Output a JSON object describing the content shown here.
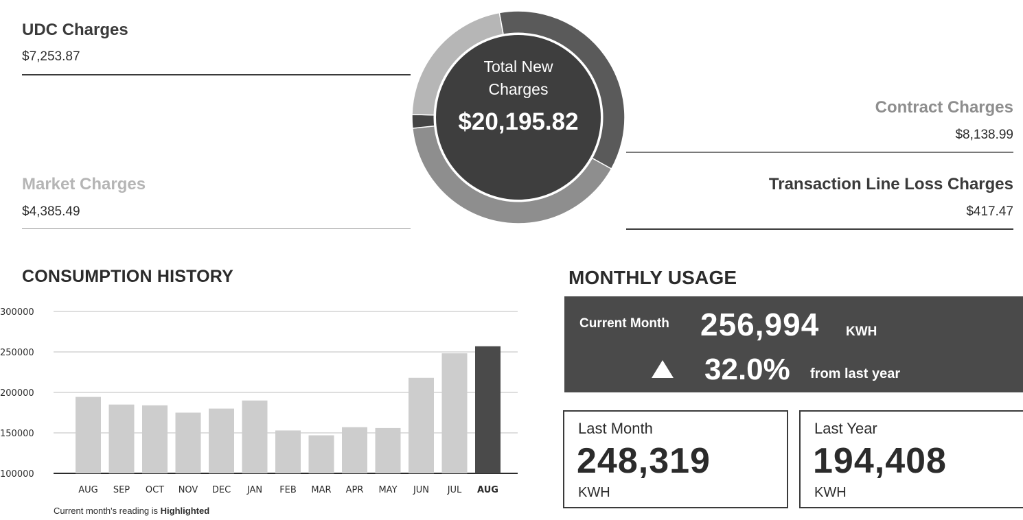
{
  "charges": {
    "udc": {
      "label": "UDC Charges",
      "value": "$7,253.87"
    },
    "market": {
      "label": "Market Charges",
      "value": "$4,385.49"
    },
    "contract": {
      "label": "Contract Charges",
      "value": "$8,138.99"
    },
    "line_loss": {
      "label": "Transaction Line Loss Charges",
      "value": "$417.47"
    }
  },
  "total": {
    "label_line1": "Total New",
    "label_line2": "Charges",
    "value": "$20,195.82"
  },
  "donut_colors": {
    "udc": "#5a5a5a",
    "contract": "#8e8e8e",
    "line_loss": "#444444",
    "market": "#b6b6b6",
    "center": "#3e3e3e",
    "text": "#ffffff"
  },
  "consumption": {
    "title": "CONSUMPTION HISTORY",
    "note_prefix": "Current month's reading is ",
    "note_highlight": "Highlighted"
  },
  "monthly": {
    "title": "MONTHLY USAGE",
    "current_label": "Current Month",
    "current_value": "256,994",
    "current_unit": "KWH",
    "change_value": "32.0%",
    "change_text": "from last year",
    "last_month_label": "Last Month",
    "last_month_value": "248,319",
    "last_month_unit": "KWH",
    "last_year_label": "Last Year",
    "last_year_value": "194,408",
    "last_year_unit": "KWH"
  },
  "chart_data": {
    "type": "bar",
    "title": "CONSUMPTION HISTORY",
    "categories": [
      "AUG",
      "SEP",
      "OCT",
      "NOV",
      "DEC",
      "JAN",
      "FEB",
      "MAR",
      "APR",
      "MAY",
      "JUN",
      "JUL",
      "AUG"
    ],
    "values": [
      194408,
      185000,
      184000,
      175000,
      180000,
      190000,
      153000,
      147000,
      157000,
      156000,
      218000,
      248319,
      256994
    ],
    "highlight_index": 12,
    "ylim": [
      100000,
      300000
    ],
    "yticks": [
      100000,
      150000,
      200000,
      250000,
      300000
    ],
    "bar_color": "#cdcdcd",
    "highlight_color": "#4a4a4a",
    "grid": true
  }
}
